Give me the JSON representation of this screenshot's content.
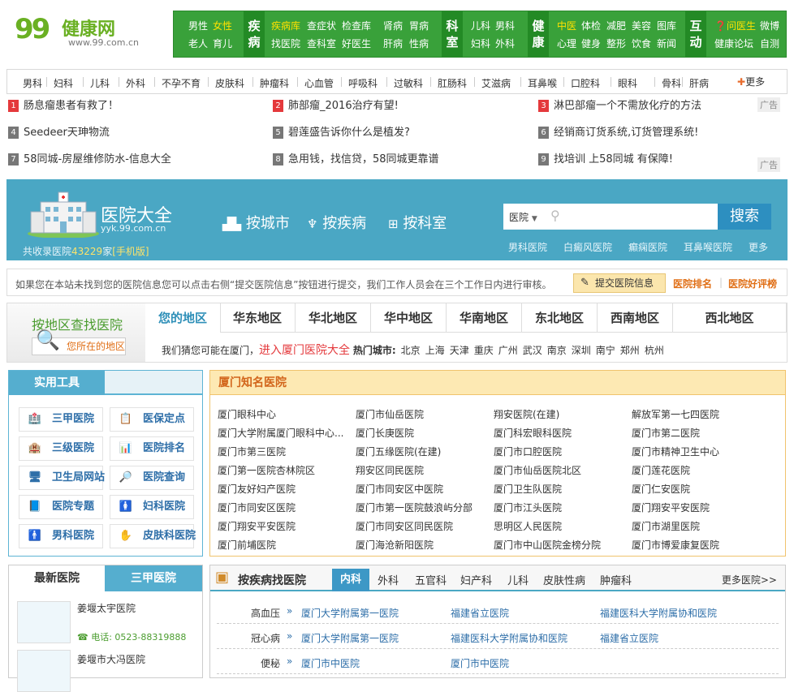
{
  "logo": {
    "mark": "99",
    "name": "健康网",
    "url": "www.99.com.cn"
  },
  "topnav": {
    "g1": [
      "男性",
      "女性",
      "老人",
      "育儿"
    ],
    "g2": {
      "tag": "疾病",
      "links": [
        "疾病库",
        "查症状",
        "检查库",
        "肾病",
        "胃病",
        "找医院",
        "查科室",
        "好医生",
        "肝病",
        "性病"
      ]
    },
    "g3": {
      "tag": "科室",
      "links": [
        "儿科",
        "男科",
        "妇科",
        "外科"
      ]
    },
    "g4": {
      "tag": "健康",
      "links": [
        "中医",
        "体检",
        "减肥",
        "美容",
        "图库",
        "心理",
        "健身",
        "整形",
        "饮食",
        "新闻"
      ]
    },
    "g5": {
      "tag": "互动",
      "links": [
        "问医生",
        "微博",
        "健康论坛",
        "自测"
      ]
    }
  },
  "categories": [
    "男科",
    "妇科",
    "儿科",
    "外科",
    "不孕不育",
    "皮肤科",
    "肿瘤科",
    "心血管",
    "呼吸科",
    "过敏科",
    "肛肠科",
    "艾滋病",
    "耳鼻喉",
    "口腔科",
    "眼科",
    "骨科",
    "肝病"
  ],
  "more_label": "更多",
  "ads": [
    [
      "1",
      "肠息瘤患者有救了！",
      "2",
      "肺部瘤_2016治疗有望!",
      "3",
      "淋巴部瘤一个不需放化疗的方法"
    ],
    [
      "4",
      "Seedeer天珅物流",
      "5",
      "碧莲盛告诉你什么是植发?",
      "6",
      "经销商订货系统,订货管理系统!"
    ],
    [
      "7",
      "58同城-房屋维修防水-信息大全",
      "8",
      "急用钱，找信贷，58同城更靠谱",
      "9",
      "找培训 上58同城 有保障!"
    ]
  ],
  "ad_label": "广告",
  "banner": {
    "title": "医院大全",
    "url": "yyk.99.com.cn",
    "count_prefix": "共收录医院",
    "count": "43229",
    "count_suffix": "家",
    "mobile": "[手机版]",
    "tabs": [
      "按城市",
      "按疾病",
      "按科室"
    ],
    "search_select": "医院",
    "search_button": "搜索",
    "links": [
      "男科医院",
      "白癜风医院",
      "癫痫医院",
      "耳鼻喉医院",
      "更多"
    ]
  },
  "notice": {
    "text": "如果您在本站未找到您的医院信息您可以点击右侧“提交医院信息”按钮进行提交，我们工作人员会在三个工作日内进行审核。",
    "submit": "提交医院信息",
    "rank": "医院排名",
    "review": "医院好评榜"
  },
  "region": {
    "title": "按地区查找医院",
    "locate": "您所在的地区",
    "tabs": [
      "您的地区",
      "华东地区",
      "华北地区",
      "华中地区",
      "华南地区",
      "东北地区",
      "西南地区",
      "西北地区"
    ],
    "guess": "我们猜您可能在厦门，",
    "enter": "进入厦门医院大全",
    "hot_label": "热门城市:",
    "hot": [
      "北京",
      "上海",
      "天津",
      "重庆",
      "广州",
      "武汉",
      "南京",
      "深圳",
      "南宁",
      "郑州",
      "杭州"
    ]
  },
  "tools": {
    "title": "实用工具",
    "items": [
      "三甲医院",
      "医保定点",
      "三级医院",
      "医院排名",
      "卫生局网站",
      "医院查询",
      "医院专题",
      "妇科医院",
      "男科医院",
      "皮肤科医院"
    ]
  },
  "famous": {
    "title": "厦门知名医院",
    "items": [
      "厦门眼科中心",
      "厦门市仙岳医院",
      "翔安医院(在建)",
      "解放军第一七四医院",
      "厦门大学附属厦门眼科中心...",
      "厦门长庚医院",
      "厦门科宏眼科医院",
      "厦门市第二医院",
      "厦门市第三医院",
      "厦门五缘医院(在建)",
      "厦门市口腔医院",
      "厦门市精神卫生中心",
      "厦门第一医院杏林院区",
      "翔安区同民医院",
      "厦门市仙岳医院北区",
      "厦门莲花医院",
      "厦门友好妇产医院",
      "厦门市同安区中医院",
      "厦门卫生队医院",
      "厦门仁安医院",
      "厦门市同安区医院",
      "厦门市第一医院鼓浪屿分部",
      "厦门市江头医院",
      "厦门翔安平安医院",
      "厦门翔安平安医院",
      "厦门市同安区同民医院",
      "思明区人民医院",
      "厦门市湖里医院",
      "厦门前埔医院",
      "厦门海沧新阳医院",
      "厦门市中山医院金榜分院",
      "厦门市博爱康复医院"
    ]
  },
  "newhosp": {
    "tab1": "最新医院",
    "tab2": "三甲医院",
    "items": [
      {
        "name": "姜堰太宇医院",
        "phone_label": "电话:",
        "phone": "0523-88319888"
      },
      {
        "name": "姜堰市大冯医院"
      }
    ]
  },
  "disease": {
    "title": "按疾病找医院",
    "tabs": [
      "内科",
      "外科",
      "五官科",
      "妇产科",
      "儿科",
      "皮肤性病",
      "肿瘤科"
    ],
    "more": "更多医院>>",
    "rows": [
      {
        "k": "高血压",
        "h": [
          "厦门大学附属第一医院",
          "福建省立医院",
          "福建医科大学附属协和医院"
        ]
      },
      {
        "k": "冠心病",
        "h": [
          "厦门大学附属第一医院",
          "福建医科大学附属协和医院",
          "福建省立医院"
        ]
      },
      {
        "k": "便秘",
        "h": [
          "厦门市中医院",
          "厦门市中医院"
        ]
      }
    ]
  },
  "colors": {
    "green": "#39a13a",
    "teal": "#4aa7c4",
    "orange": "#d2651b"
  }
}
